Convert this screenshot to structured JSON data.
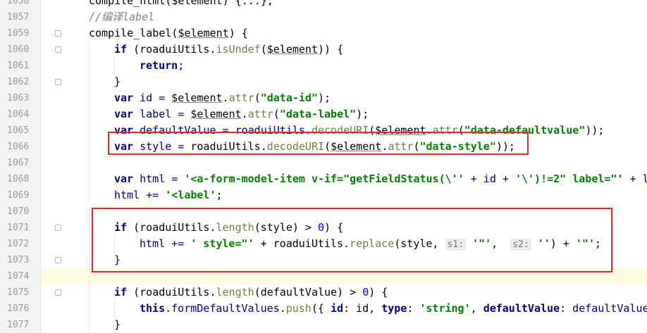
{
  "lines": [
    {
      "num": "1058",
      "indent": 1,
      "fold": false,
      "tokens": [
        {
          "t": "compile_html($element) {...};",
          "c": ""
        }
      ]
    },
    {
      "num": "1057",
      "indent": 1,
      "fold": false,
      "tokens": [
        {
          "t": "//编译label",
          "c": "cm"
        }
      ]
    },
    {
      "num": "1059",
      "indent": 1,
      "fold": true,
      "tokens": [
        {
          "t": "compile_label(",
          "c": ""
        },
        {
          "t": "$element",
          "c": "ul"
        },
        {
          "t": ") {",
          "c": ""
        }
      ]
    },
    {
      "num": "1060",
      "indent": 2,
      "fold": true,
      "tokens": [
        {
          "t": "if",
          "c": "kw"
        },
        {
          "t": " (roaduiUtils.",
          "c": ""
        },
        {
          "t": "isUndef",
          "c": "fn"
        },
        {
          "t": "(",
          "c": ""
        },
        {
          "t": "$element",
          "c": "ul"
        },
        {
          "t": ")) {",
          "c": ""
        }
      ]
    },
    {
      "num": "1061",
      "indent": 3,
      "fold": false,
      "tokens": [
        {
          "t": "return",
          "c": "kw"
        },
        {
          "t": ";",
          "c": ""
        }
      ]
    },
    {
      "num": "1062",
      "indent": 2,
      "fold": true,
      "tokens": [
        {
          "t": "}",
          "c": ""
        }
      ]
    },
    {
      "num": "1063",
      "indent": 2,
      "fold": false,
      "tokens": [
        {
          "t": "var",
          "c": "kw"
        },
        {
          "t": " id = ",
          "c": "v"
        },
        {
          "t": "$element",
          "c": "ul"
        },
        {
          "t": ".",
          "c": ""
        },
        {
          "t": "attr",
          "c": "fn"
        },
        {
          "t": "(",
          "c": ""
        },
        {
          "t": "\"data-id\"",
          "c": "str"
        },
        {
          "t": ");",
          "c": ""
        }
      ]
    },
    {
      "num": "1064",
      "indent": 2,
      "fold": false,
      "tokens": [
        {
          "t": "var",
          "c": "kw"
        },
        {
          "t": " label = ",
          "c": "v"
        },
        {
          "t": "$element",
          "c": "ul"
        },
        {
          "t": ".",
          "c": ""
        },
        {
          "t": "attr",
          "c": "fn"
        },
        {
          "t": "(",
          "c": ""
        },
        {
          "t": "\"data-label\"",
          "c": "str"
        },
        {
          "t": ");",
          "c": ""
        }
      ]
    },
    {
      "num": "1065",
      "indent": 2,
      "fold": false,
      "tokens": [
        {
          "t": "var",
          "c": "kw"
        },
        {
          "t": " defaultValue = roaduiUtils.",
          "c": "v"
        },
        {
          "t": "decodeURI",
          "c": "fn"
        },
        {
          "t": "(",
          "c": ""
        },
        {
          "t": "$element",
          "c": "ul"
        },
        {
          "t": ".",
          "c": ""
        },
        {
          "t": "attr",
          "c": "fn"
        },
        {
          "t": "(",
          "c": ""
        },
        {
          "t": "\"data-defaultvalue\"",
          "c": "str"
        },
        {
          "t": "));",
          "c": ""
        }
      ]
    },
    {
      "num": "1066",
      "indent": 2,
      "fold": false,
      "tokens": [
        {
          "t": "var",
          "c": "kw"
        },
        {
          "t": " style = ",
          "c": "v"
        },
        {
          "t": "roaduiUtils.",
          "c": ""
        },
        {
          "t": "decodeURI",
          "c": "fn"
        },
        {
          "t": "(",
          "c": ""
        },
        {
          "t": "$element",
          "c": "ul"
        },
        {
          "t": ".",
          "c": ""
        },
        {
          "t": "attr",
          "c": "fn"
        },
        {
          "t": "(",
          "c": ""
        },
        {
          "t": "\"data-style\"",
          "c": "str"
        },
        {
          "t": "));",
          "c": ""
        }
      ]
    },
    {
      "num": "1067",
      "indent": 2,
      "fold": false,
      "tokens": []
    },
    {
      "num": "1068",
      "indent": 2,
      "fold": false,
      "tokens": [
        {
          "t": "var",
          "c": "kw"
        },
        {
          "t": " html = ",
          "c": "v"
        },
        {
          "t": "'<a-form-model-item v-if=\"getFieldStatus(\\'' ",
          "c": "str"
        },
        {
          "t": "+ id + ",
          "c": "v"
        },
        {
          "t": "'\\')!=2\" label=\"' ",
          "c": "str"
        },
        {
          "t": "+ l",
          "c": "v"
        }
      ]
    },
    {
      "num": "1069",
      "indent": 2,
      "fold": false,
      "tokens": [
        {
          "t": "html += ",
          "c": "v"
        },
        {
          "t": "'<label'",
          "c": "str"
        },
        {
          "t": ";",
          "c": ""
        }
      ]
    },
    {
      "num": "1070",
      "indent": 2,
      "fold": false,
      "tokens": []
    },
    {
      "num": "1071",
      "indent": 2,
      "fold": true,
      "tokens": [
        {
          "t": "if",
          "c": "kw"
        },
        {
          "t": " (roaduiUtils.",
          "c": ""
        },
        {
          "t": "length",
          "c": "fn"
        },
        {
          "t": "(style) > ",
          "c": ""
        },
        {
          "t": "0",
          "c": "num"
        },
        {
          "t": ") {",
          "c": ""
        }
      ]
    },
    {
      "num": "1072",
      "indent": 3,
      "fold": false,
      "tokens": [
        {
          "t": "html += ",
          "c": "v"
        },
        {
          "t": "' style=\"' ",
          "c": "str"
        },
        {
          "t": "+ roaduiUtils.",
          "c": ""
        },
        {
          "t": "replace",
          "c": "fn"
        },
        {
          "t": "(style, ",
          "c": ""
        },
        {
          "t": "s1:",
          "c": "hint"
        },
        {
          "t": " ",
          "c": ""
        },
        {
          "t": "'\"'",
          "c": "str"
        },
        {
          "t": ",  ",
          "c": ""
        },
        {
          "t": "s2:",
          "c": "hint"
        },
        {
          "t": " ",
          "c": ""
        },
        {
          "t": "''",
          "c": "str"
        },
        {
          "t": ") + ",
          "c": ""
        },
        {
          "t": "'\"'",
          "c": "str"
        },
        {
          "t": ";",
          "c": ""
        }
      ]
    },
    {
      "num": "1073",
      "indent": 2,
      "fold": true,
      "tokens": [
        {
          "t": "}",
          "c": ""
        }
      ]
    },
    {
      "num": "1074",
      "indent": 2,
      "fold": false,
      "current": true,
      "tokens": []
    },
    {
      "num": "1075",
      "indent": 2,
      "fold": true,
      "tokens": [
        {
          "t": "if",
          "c": "kw"
        },
        {
          "t": " (roaduiUtils.",
          "c": ""
        },
        {
          "t": "length",
          "c": "fn"
        },
        {
          "t": "(defaultValue) > ",
          "c": ""
        },
        {
          "t": "0",
          "c": "num"
        },
        {
          "t": ") {",
          "c": ""
        }
      ]
    },
    {
      "num": "1076",
      "indent": 3,
      "fold": false,
      "tokens": [
        {
          "t": "this",
          "c": "kw"
        },
        {
          "t": ".",
          "c": ""
        },
        {
          "t": "formDefaultValues",
          "c": "v"
        },
        {
          "t": ".",
          "c": ""
        },
        {
          "t": "push",
          "c": "fn"
        },
        {
          "t": "({ ",
          "c": ""
        },
        {
          "t": "id",
          "c": "kw"
        },
        {
          "t": ": id, ",
          "c": ""
        },
        {
          "t": "type",
          "c": "kw"
        },
        {
          "t": ": ",
          "c": ""
        },
        {
          "t": "'string'",
          "c": "str"
        },
        {
          "t": ", ",
          "c": ""
        },
        {
          "t": "defaultValue",
          "c": "kw"
        },
        {
          "t": ": defaultValue",
          "c": "v"
        }
      ]
    },
    {
      "num": "1077",
      "indent": 2,
      "fold": false,
      "tokens": [
        {
          "t": "}",
          "c": ""
        }
      ]
    }
  ]
}
